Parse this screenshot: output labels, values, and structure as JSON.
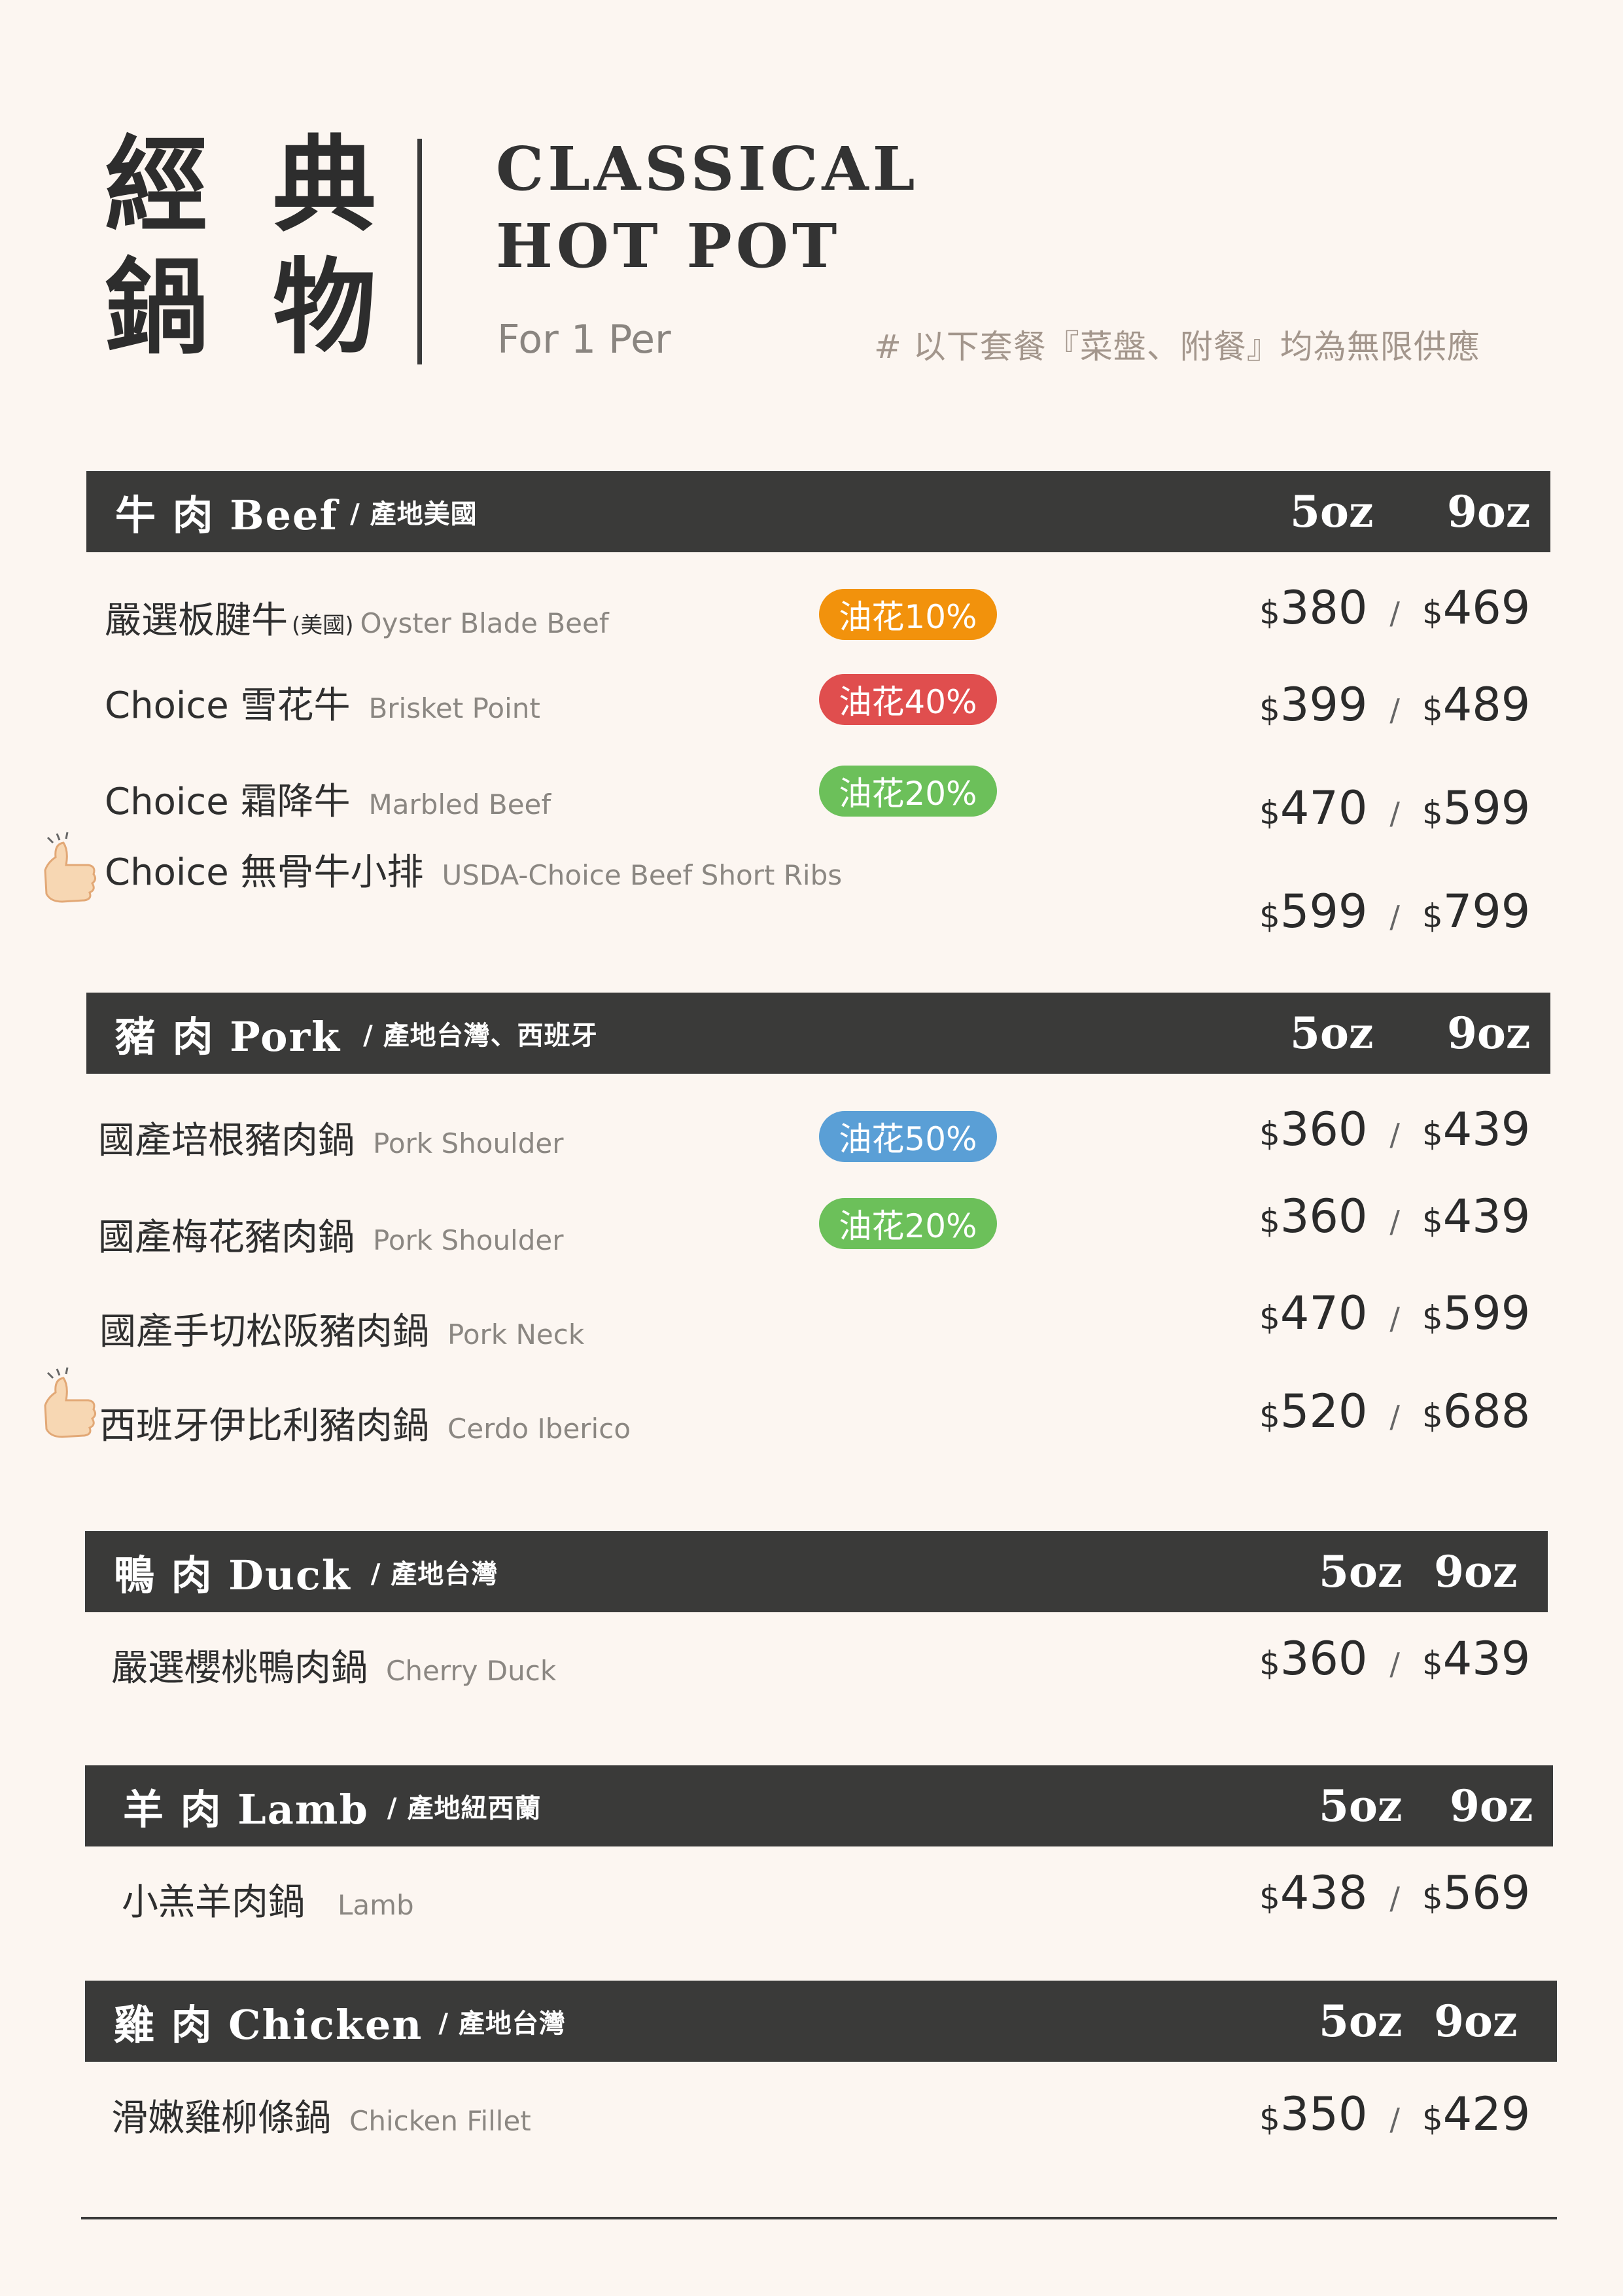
{
  "header": {
    "title_cn_line1": "經 典",
    "title_cn_line2": "鍋 物",
    "title_en_line1": "CLASSICAL",
    "title_en_line2": "HOT POT",
    "subtitle": "For 1 Per",
    "note": "# 以下套餐『菜盤、附餐』均為無限供應"
  },
  "sizes": {
    "small": "5oz",
    "large": "9oz"
  },
  "currency": "$",
  "sections": {
    "beef": {
      "title": "牛 肉 Beef",
      "origin": "/ 產地美國",
      "items": [
        {
          "name": "嚴選板腱牛",
          "tag": "(美國)",
          "en": "Oyster Blade Beef",
          "badge": "油花10%",
          "badge_color": "#f2920c",
          "p1": "380",
          "p2": "469"
        },
        {
          "name": "Choice 雪花牛",
          "en": "Brisket  Point",
          "badge": "油花40%",
          "badge_color": "#e04e4e",
          "p1": "399",
          "p2": "489"
        },
        {
          "name": "Choice 霜降牛",
          "en": "Marbled Beef",
          "badge": "油花20%",
          "badge_color": "#6cc05a",
          "p1": "470",
          "p2": "599"
        },
        {
          "name": "Choice 無骨牛小排",
          "en": "USDA-Choice Beef Short Ribs",
          "p1": "599",
          "p2": "799"
        }
      ]
    },
    "pork": {
      "title": "豬 肉 Pork",
      "origin": "/ 產地台灣、西班牙",
      "items": [
        {
          "name": "國產培根豬肉鍋",
          "en": "Pork Shoulder",
          "badge": "油花50%",
          "badge_color": "#5a9fd6",
          "p1": "360",
          "p2": "439"
        },
        {
          "name": "國產梅花豬肉鍋",
          "en": "Pork Shoulder",
          "badge": "油花20%",
          "badge_color": "#6cc05a",
          "p1": "360",
          "p2": "439"
        },
        {
          "name": "國產手切松阪豬肉鍋",
          "en": "Pork Neck",
          "p1": "470",
          "p2": "599"
        },
        {
          "name": "西班牙伊比利豬肉鍋",
          "en": "Cerdo Iberico",
          "p1": "520",
          "p2": "688"
        }
      ]
    },
    "duck": {
      "title": "鴨 肉 Duck",
      "origin": "/ 產地台灣",
      "items": [
        {
          "name": "嚴選櫻桃鴨肉鍋",
          "en": "Cherry Duck",
          "p1": "360",
          "p2": "439"
        }
      ]
    },
    "lamb": {
      "title": "羊 肉 Lamb",
      "origin": "/ 產地紐西蘭",
      "items": [
        {
          "name": "小羔羊肉鍋",
          "en": "Lamb",
          "p1": "438",
          "p2": "569"
        }
      ]
    },
    "chicken": {
      "title": "雞 肉 Chicken",
      "origin": "/ 產地台灣",
      "items": [
        {
          "name": "滑嫩雞柳條鍋",
          "en": "Chicken Fillet",
          "p1": "350",
          "p2": "429"
        }
      ]
    }
  }
}
